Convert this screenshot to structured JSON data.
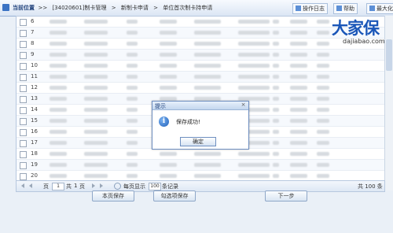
{
  "header": {
    "location_label": "当前位置",
    "breadcrumb": [
      "[34020601]制卡管理",
      ">",
      "新制卡申请",
      ">",
      "单位首次制卡持申请"
    ],
    "buttons": [
      "操作日志",
      "帮助",
      "最大化"
    ]
  },
  "logo": {
    "brand": "大家保",
    "url": "dajiabao.com"
  },
  "grid": {
    "row_numbers": [
      "6",
      "7",
      "8",
      "9",
      "10",
      "11",
      "12",
      "13",
      "14",
      "15",
      "16",
      "17",
      "18",
      "19",
      "20"
    ]
  },
  "pager": {
    "page_prefix": "页",
    "page_value": "1",
    "total_prefix": "共",
    "total_pages": "1",
    "total_suffix": "页",
    "per_page_prefix": "每页显示",
    "per_page_value": "100",
    "per_page_suffix": "条记录",
    "total_records": "共 100 条"
  },
  "buttons": {
    "save_page": "本页保存",
    "save_checked": "勾选项保存",
    "next_step": "下一步"
  },
  "modal": {
    "title": "提示",
    "message": "保存成功!",
    "ok": "确定",
    "close": "×",
    "info_glyph": "i"
  }
}
